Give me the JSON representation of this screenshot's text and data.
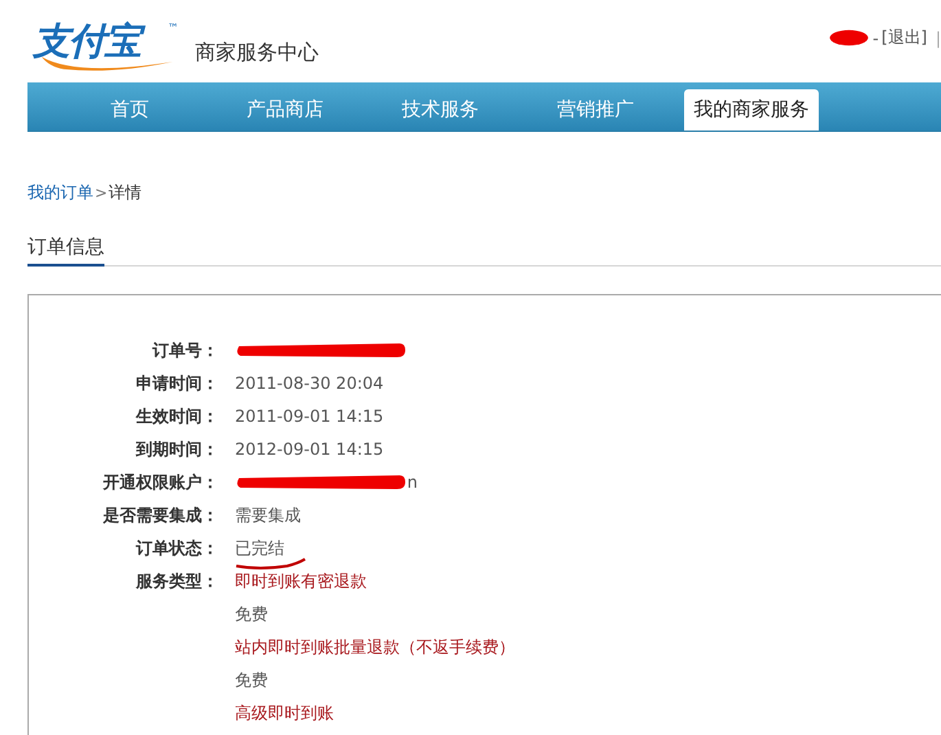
{
  "header": {
    "logo": "支付宝",
    "trademark": "™",
    "title": "商家服务中心",
    "user": {
      "redacted": true
    },
    "separator": "-",
    "logout": "[退出]",
    "divider": "|"
  },
  "tabs": [
    {
      "label": "首页",
      "selected": false
    },
    {
      "label": "产品商店",
      "selected": false
    },
    {
      "label": "技术服务",
      "selected": false
    },
    {
      "label": "营销推广",
      "selected": false
    },
    {
      "label": "我的商家服务",
      "selected": true
    }
  ],
  "breadcrumb": {
    "link": "我的订单",
    "separator": ">",
    "current": "详情"
  },
  "section_title": "订单信息",
  "fields": [
    {
      "label": "订单号：",
      "kind": "redacted"
    },
    {
      "label": "申请时间：",
      "kind": "text",
      "value": "2011-08-30 20:04"
    },
    {
      "label": "生效时间：",
      "kind": "text",
      "value": "2011-09-01 14:15"
    },
    {
      "label": "到期时间：",
      "kind": "text",
      "value": "2012-09-01 14:15"
    },
    {
      "label": "开通权限账户：",
      "kind": "redacted",
      "value": "n"
    },
    {
      "label": "是否需要集成：",
      "kind": "text",
      "value": "需要集成"
    },
    {
      "label": "订单状态：",
      "kind": "marked",
      "value": "已完结"
    },
    {
      "label": "服务类型：",
      "kind": "service",
      "value": "即时到账有密退款"
    },
    {
      "kind": "fee",
      "value": "免费"
    },
    {
      "kind": "service",
      "value": "站内即时到账批量退款（不返手续费）"
    },
    {
      "kind": "fee",
      "value": "免费"
    },
    {
      "kind": "service",
      "value": "高级即时到账"
    }
  ]
}
